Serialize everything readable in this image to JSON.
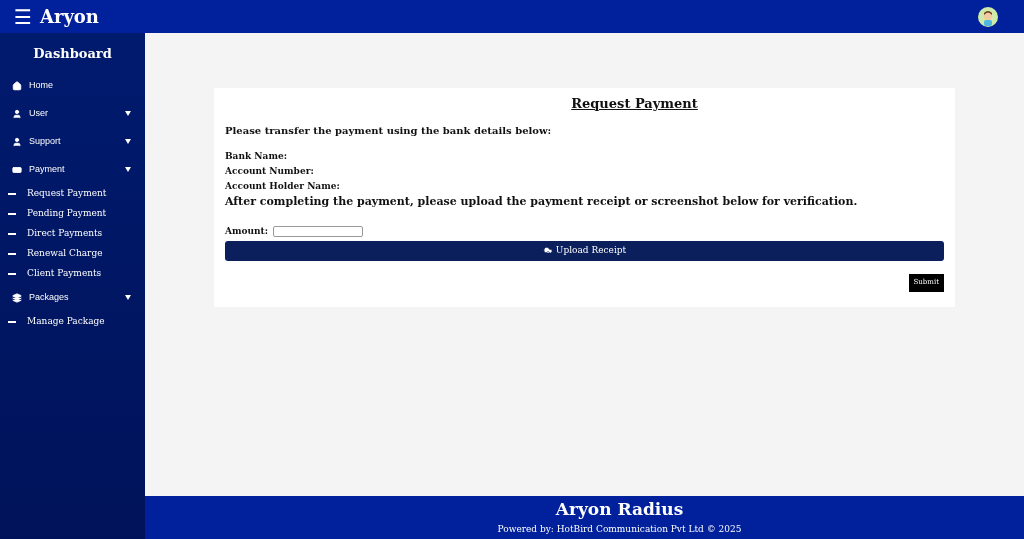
{
  "header": {
    "menu_glyph": "☰",
    "brand": "Aryon"
  },
  "sidebar": {
    "title": "Dashboard",
    "items": [
      {
        "label": "Home",
        "dropdown": false
      },
      {
        "label": "User",
        "dropdown": true
      },
      {
        "label": "Support",
        "dropdown": true
      },
      {
        "label": "Payment",
        "dropdown": true,
        "children": [
          {
            "label": "Request Payment"
          },
          {
            "label": "Pending Payment"
          },
          {
            "label": "Direct Payments"
          },
          {
            "label": "Renewal Charge"
          },
          {
            "label": "Client Payments"
          }
        ]
      },
      {
        "label": "Packages",
        "dropdown": true,
        "children": [
          {
            "label": "Manage Package"
          }
        ]
      }
    ]
  },
  "card": {
    "title": "Request Payment",
    "intro": "Please transfer the payment using the bank details below:",
    "details": [
      "Bank Name:",
      "Account Number:",
      "Account Holder Name:"
    ],
    "instruction": "After completing the payment, please upload the payment receipt or screenshot below for verification.",
    "amount_label": "Amount:",
    "upload_button": "Upload Receipt",
    "submit_button": "Submit"
  },
  "footer": {
    "title": "Aryon Radius",
    "credit": "Powered by: HotBird Communication Pvt Ltd © 2025"
  }
}
